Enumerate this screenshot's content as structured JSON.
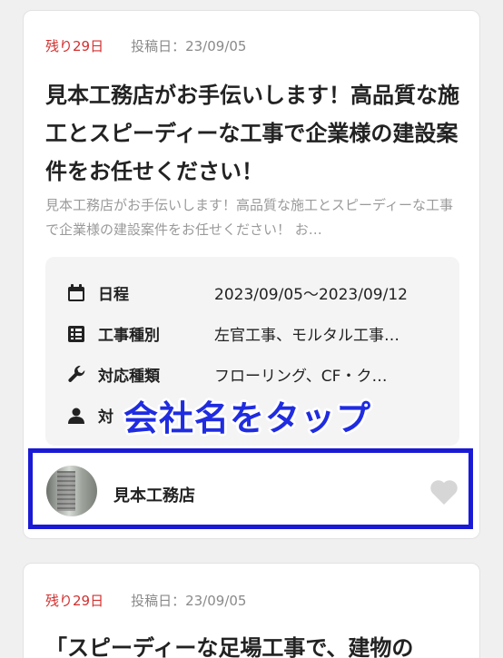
{
  "card1": {
    "remaining": "残り29日",
    "posted": "投稿日：23/09/05",
    "title": "見本工務店がお手伝いします！高品質な施工とスピーディーな工事で企業様の建設案件をお任せください！",
    "excerpt": "見本工務店がお手伝いします！高品質な施工とスピーディーな工事で企業様の建設案件をお任せください！ お…",
    "info": [
      {
        "icon": "calendar-icon",
        "label": "日程",
        "value": "2023/09/05〜2023/09/12"
      },
      {
        "icon": "list-icon",
        "label": "工事種別",
        "value": "左官工事、モルタル工事…"
      },
      {
        "icon": "wrench-icon",
        "label": "対応種類",
        "value": "フローリング、CF・ク…"
      },
      {
        "icon": "person-icon",
        "label": "対",
        "value": ""
      }
    ],
    "company_name": "見本工務店"
  },
  "overlay_instruction": "会社名をタップ",
  "card2": {
    "remaining": "残り29日",
    "posted": "投稿日：23/09/05",
    "title": "「スピーディーな足場工事で、建物の"
  },
  "colors": {
    "accent_red": "#d32f2f",
    "highlight_blue": "#1a1ad6",
    "overlay_blue": "#1f2ce0"
  }
}
